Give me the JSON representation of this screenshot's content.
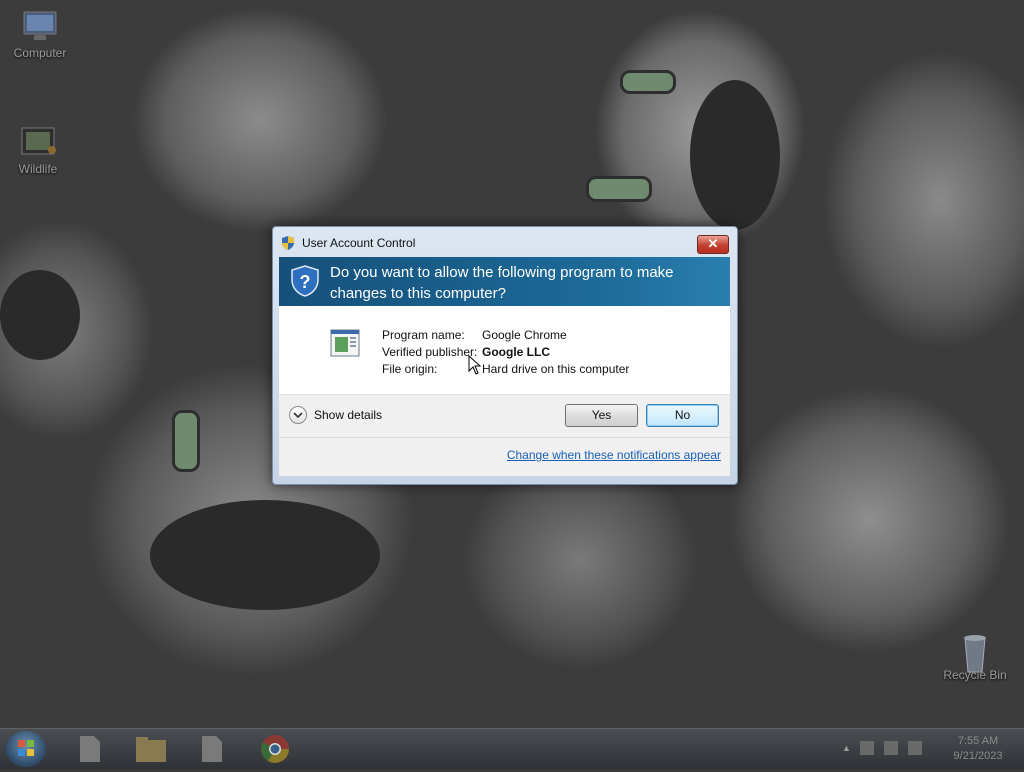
{
  "desktop": {
    "icons": [
      {
        "label": "Computer"
      },
      {
        "label": "Wildlife"
      },
      {
        "label": "Recycle Bin"
      }
    ]
  },
  "dialog": {
    "title": "User Account Control",
    "close_label": "✕",
    "question": "Do you want to allow the following program to make changes to this computer?",
    "details": {
      "program_name_label": "Program name:",
      "program_name_value": "Google Chrome",
      "publisher_label": "Verified publisher:",
      "publisher_value": "Google LLC",
      "origin_label": "File origin:",
      "origin_value": "Hard drive on this computer"
    },
    "show_details_label": "Show details",
    "yes_label": "Yes",
    "no_label": "No",
    "change_link": "Change when these notifications appear"
  },
  "taskbar": {
    "clock_time": "7:55 AM",
    "clock_date": "9/21/2023",
    "show_hidden_icons": "▲"
  },
  "colors": {
    "banner": "#1c6a98",
    "link": "#1a5fb4",
    "close_button": "#c33f2e"
  }
}
